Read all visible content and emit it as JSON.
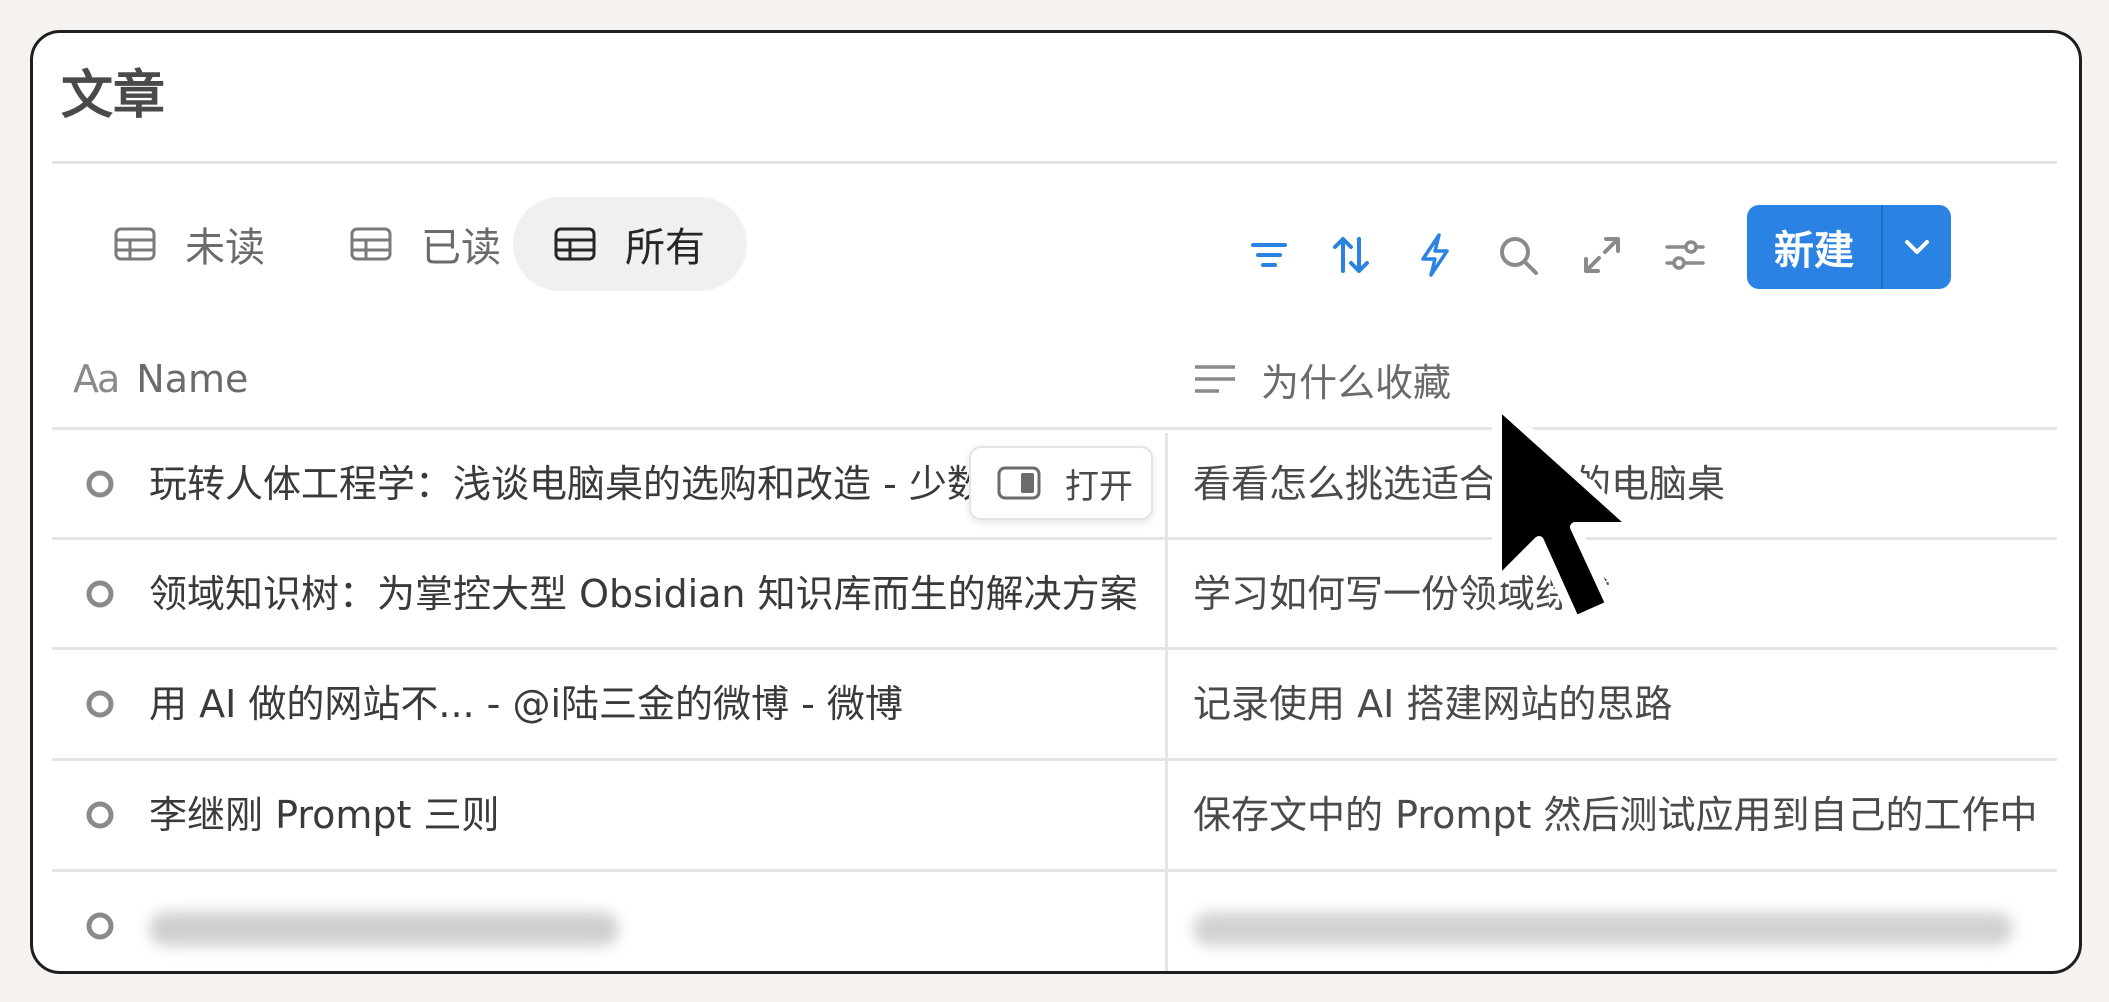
{
  "page": {
    "title": "文章"
  },
  "views": [
    {
      "label": "未读",
      "icon": "table-icon",
      "active": false
    },
    {
      "label": "已读",
      "icon": "table-icon",
      "active": false
    },
    {
      "label": "所有",
      "icon": "table-icon",
      "active": true
    }
  ],
  "toolbar": {
    "tools": [
      "filter-icon",
      "sort-icon",
      "automation-icon",
      "search-icon",
      "expand-icon",
      "settings-icon"
    ],
    "new_label": "新建",
    "accent_color": "#2a83e2",
    "icon_color": "#2a83e2"
  },
  "table": {
    "columns": [
      {
        "label": "Name",
        "icon": "Aa"
      },
      {
        "label": "为什么收藏",
        "icon": "text-lines-icon"
      }
    ],
    "rows": [
      {
        "name": "玩转人体工程学：浅谈电脑桌的选购和改造 - 少数派",
        "why": "看看怎么挑选适合自己的电脑桌"
      },
      {
        "name": "领域知识树：为掌控大型 Obsidian 知识库而生的解决方案",
        "why": "学习如何写一份领域综述"
      },
      {
        "name": "用 AI 做的网站不... - @i陆三金的微博 - 微博",
        "why": "记录使用 AI 搭建网站的思路"
      },
      {
        "name": "李继刚 Prompt 三则",
        "why": "保存文中的 Prompt 然后测试应用到自己的工作中"
      }
    ],
    "row_hover_button": "打开"
  }
}
